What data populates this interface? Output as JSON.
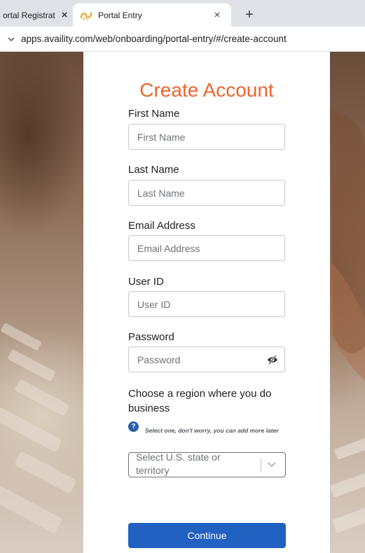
{
  "browser": {
    "tabs": [
      {
        "title": "ortal Registrat",
        "active": false
      },
      {
        "title": "Portal Entry",
        "active": true
      }
    ],
    "close_glyph": "×",
    "new_tab_glyph": "+",
    "url": "apps.availity.com/web/onboarding/portal-entry/#/create-account",
    "favicon_color": "#e9a93a"
  },
  "form": {
    "title": "Create Account",
    "title_color": "#e9662f",
    "fields": [
      {
        "label": "First Name",
        "placeholder": "First Name",
        "value": ""
      },
      {
        "label": "Last Name",
        "placeholder": "Last Name",
        "value": ""
      },
      {
        "label": "Email Address",
        "placeholder": "Email Address",
        "value": ""
      },
      {
        "label": "User ID",
        "placeholder": "User ID",
        "value": ""
      },
      {
        "label": "Password",
        "placeholder": "Password",
        "value": ""
      }
    ],
    "region": {
      "label": "Choose a region where you do business",
      "hint": "Select one, don't worry, you can add more later",
      "hint_icon": "?",
      "select_placeholder": "Select U.S. state or territory"
    },
    "continue_label": "Continue",
    "primary_color": "#2161c1"
  }
}
